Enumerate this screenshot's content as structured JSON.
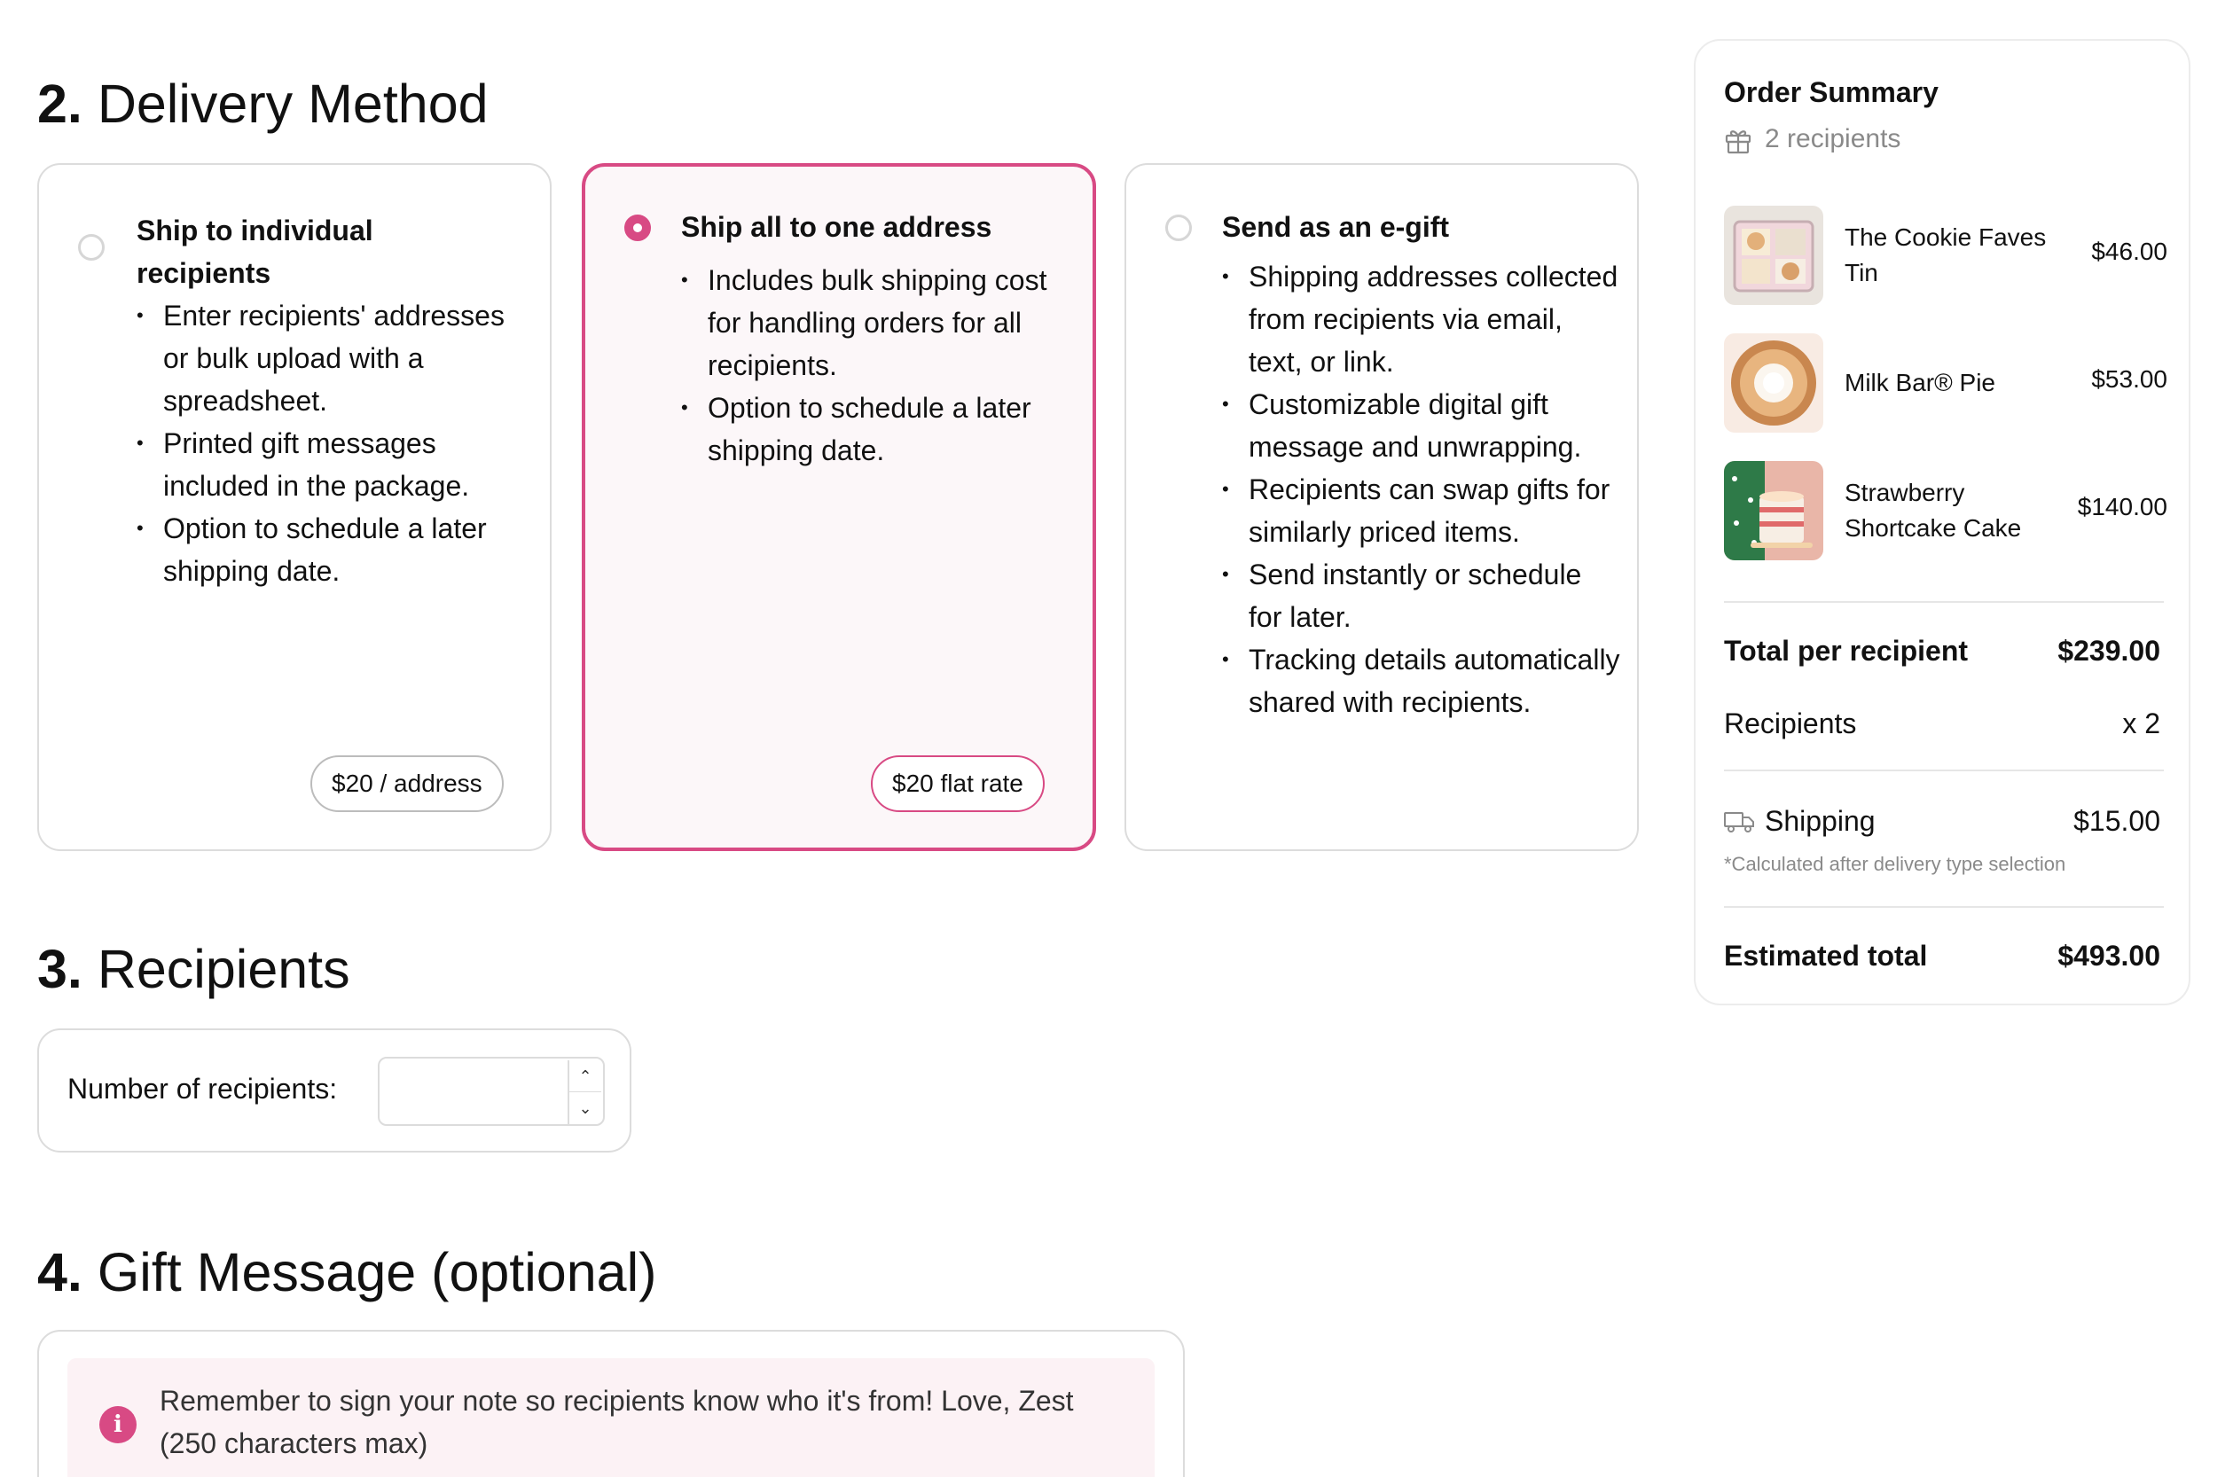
{
  "delivery": {
    "section_number": "2.",
    "section_title": "Delivery Method",
    "options": [
      {
        "title": "Ship to individual recipients",
        "selected": false,
        "bullets": [
          "Enter recipients' addresses or bulk upload with a spreadsheet.",
          "Printed gift messages included in the package.",
          "Option to schedule a later shipping date."
        ],
        "price": "$20 / address"
      },
      {
        "title": "Ship all to one address",
        "selected": true,
        "bullets": [
          "Includes bulk shipping cost for handling orders for all recipients.",
          "Option to schedule a later shipping date."
        ],
        "price": "$20 flat rate"
      },
      {
        "title": "Send as an e-gift",
        "selected": false,
        "bullets": [
          "Shipping addresses collected from recipients via email, text, or link.",
          "Customizable digital gift message and unwrapping.",
          "Recipients can swap gifts for similarly priced items.",
          "Send instantly or schedule for later.",
          "Tracking details automatically shared with recipients."
        ],
        "price": ""
      }
    ]
  },
  "recipients": {
    "section_number": "3.",
    "section_title": "Recipients",
    "label": "Number of recipients:",
    "value": ""
  },
  "gift_message": {
    "section_number": "4.",
    "section_title": "Gift Message (optional)",
    "notice": "Remember to sign your note so recipients know who it's from! Love, Zest (250 characters max)"
  },
  "summary": {
    "title": "Order Summary",
    "recipients_count": "2 recipients",
    "items": [
      {
        "name": "The Cookie Faves Tin",
        "price": "$46.00",
        "icon": "cookie-tin-photo"
      },
      {
        "name": "Milk Bar® Pie",
        "price": "$53.00",
        "icon": "pie-photo"
      },
      {
        "name": "Strawberry Shortcake Cake",
        "price": "$140.00",
        "icon": "cake-photo"
      }
    ],
    "total_per_recipient_label": "Total per recipient",
    "total_per_recipient_value": "$239.00",
    "recipients_label": "Recipients",
    "recipients_value": "x 2",
    "shipping_label": "Shipping",
    "shipping_value": "$15.00",
    "shipping_note": "*Calculated after delivery type selection",
    "estimated_total_label": "Estimated total",
    "estimated_total_value": "$493.00"
  },
  "colors": {
    "accent": "#d84a84",
    "selected_bg": "#fcf7f9",
    "border": "#dcdcdc",
    "muted_text": "#8a8a8a"
  }
}
